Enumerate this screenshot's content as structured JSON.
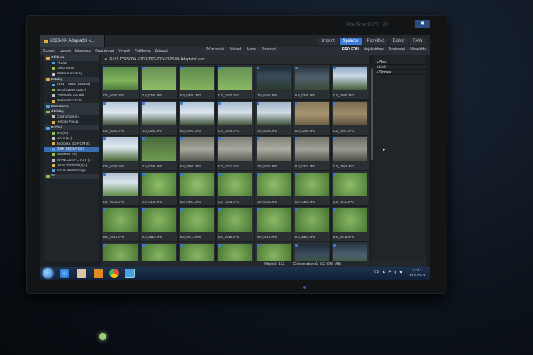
{
  "monitor": {
    "brand": "ProScan3201W"
  },
  "app": {
    "tab_title": "2023-09- Adaptační k…",
    "modes": [
      "Import",
      "Správce",
      "Prohlížeč",
      "Editor",
      "RAW"
    ],
    "active_mode": "Správce"
  },
  "menu": [
    "Zobrazit",
    "Upravit",
    "Informace",
    "Organizovat",
    "Vytvořit",
    "Publikovat",
    "Zobrazit"
  ],
  "toolbar": [
    "Průzkumník",
    "Náhled",
    "Mapa",
    "Porovnat"
  ],
  "right_toolbar": [
    "PRO EDU",
    "Nejvíkládané",
    "Nastavení",
    "Nápověda"
  ],
  "path": "G:\\ZŠ TYRŠOVA FOTO\\2023-2024\\2023-09- Adaptační kurz",
  "sidebar": [
    {
      "label": "Oblíbené",
      "type": "head"
    },
    {
      "label": "Plocha"
    },
    {
      "label": "Dokumenty"
    },
    {
      "label": "Stažené soubory"
    },
    {
      "label": "Katalog",
      "type": "head"
    },
    {
      "label": "2001 – 2023 (123366)"
    },
    {
      "label": "Nezařazeno (1061)"
    },
    {
      "label": "Posledních 30 dní"
    },
    {
      "label": "Posledních 7 dní"
    },
    {
      "label": "Zoneraama",
      "type": "head"
    },
    {
      "label": "Obrázky",
      "type": "head"
    },
    {
      "label": "ControlCenter4"
    },
    {
      "label": "Helicon Focus"
    },
    {
      "label": "Počítač",
      "type": "head"
    },
    {
      "label": "OS (C:)"
    },
    {
      "label": "DATA (D:)"
    },
    {
      "label": "Jednotka BD-ROM (E:)"
    },
    {
      "label": "DISK ŠKOLA (G:)",
      "type": "sel"
    },
    {
      "label": "SD/MMC (H:)"
    },
    {
      "label": "MARECEK FOTO 8 (I:)"
    },
    {
      "label": "home (\\\\Velesin) (Z:)"
    },
    {
      "label": "ASUS WebStorage"
    },
    {
      "label": "Síť",
      "type": "head"
    }
  ],
  "files": [
    "DJI_0284.JPG",
    "DJI_0285.JPG",
    "DJI_0286.JPG",
    "DJI_0287.JPG",
    "DJI_0288.JPG",
    "DJI_0289.JPG",
    "DJI_0290.JPG",
    "DJI_0291.JPG",
    "DJI_0292.JPG",
    "DJI_0293.JPG",
    "DJI_0294.JPG",
    "DJI_0295.JPG",
    "DJI_0296.JPG",
    "DJI_0297.JPG",
    "DJI_0298.JPG",
    "DJI_0299.JPG",
    "DJI_0300.JPG",
    "DJI_0301.JPG",
    "DJI_0302.JPG",
    "DJI_0303.JPG",
    "DJI_0304.JPG",
    "DJI_0305.JPG",
    "DJI_0306.JPG",
    "DJI_0307.JPG",
    "DJI_0308.JPG",
    "DJI_0309.JPG",
    "DJI_0310.JPG",
    "DJI_0311.JPG",
    "DJI_0312.JPG",
    "DJI_0313.JPG",
    "DJI_0314.JPG",
    "DJI_0315.JPG",
    "DJI_0316.JPG",
    "DJI_0317.JPG",
    "DJI_0318.JPG",
    "",
    "",
    "",
    "",
    "",
    "",
    ""
  ],
  "right_panel": [
    "Akce",
    "Lidé",
    "Témata"
  ],
  "status": {
    "objects": "Objektů: 162",
    "total": "Celkem objektů: 162 (980 MB)"
  },
  "taskbar": {
    "lang": "CS",
    "time": "17:27",
    "date": "20.9.2023"
  }
}
